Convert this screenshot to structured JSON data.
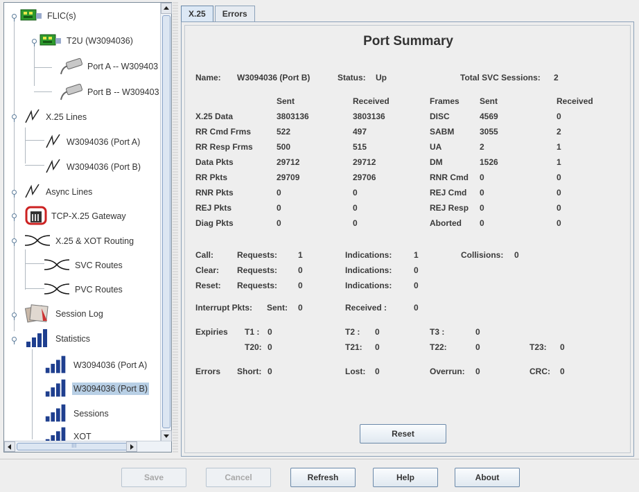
{
  "tree": {
    "items": [
      {
        "label": "FLIC(s)",
        "icon": "board-icon"
      },
      {
        "label": "T2U (W3094036)",
        "icon": "board-icon"
      },
      {
        "label": "Port A -- W309403",
        "icon": "cable-icon"
      },
      {
        "label": "Port B -- W309403",
        "icon": "cable-icon"
      },
      {
        "label": "X.25 Lines",
        "icon": "line-icon"
      },
      {
        "label": "W3094036 (Port A)",
        "icon": "line-icon"
      },
      {
        "label": "W3094036 (Port B)",
        "icon": "line-icon"
      },
      {
        "label": "Async Lines",
        "icon": "line-icon"
      },
      {
        "label": "TCP-X.25 Gateway",
        "icon": "gateway-icon"
      },
      {
        "label": "X.25 & XOT Routing",
        "icon": "routing-icon"
      },
      {
        "label": "SVC Routes",
        "icon": "routing-icon"
      },
      {
        "label": "PVC Routes",
        "icon": "routing-icon"
      },
      {
        "label": "Session Log",
        "icon": "log-icon"
      },
      {
        "label": "Statistics",
        "icon": "stats-icon"
      },
      {
        "label": "W3094036 (Port A)",
        "icon": "stats-icon"
      },
      {
        "label": "W3094036 (Port B)",
        "icon": "stats-icon"
      },
      {
        "label": "Sessions",
        "icon": "stats-icon"
      },
      {
        "label": "XOT",
        "icon": "stats-icon"
      }
    ],
    "hscroll_grip": "III"
  },
  "tabs": [
    {
      "label": "X.25"
    },
    {
      "label": "Errors"
    }
  ],
  "summary": {
    "title": "Port Summary",
    "name_label": "Name:",
    "name_value": "W3094036 (Port B)",
    "status_label": "Status:",
    "status_value": "Up",
    "total_svc_label": "Total SVC Sessions:",
    "total_svc_value": "2",
    "headers": {
      "sent": "Sent",
      "received": "Received",
      "frames": "Frames",
      "frames_sent": "Sent",
      "frames_received": "Received"
    },
    "rows": [
      {
        "label": "X.25 Data",
        "sent": "3803136",
        "received": "3803136",
        "frame": "DISC",
        "fsent": "4569",
        "freceived": "0"
      },
      {
        "label": "RR Cmd Frms",
        "sent": "522",
        "received": "497",
        "frame": "SABM",
        "fsent": "3055",
        "freceived": "2"
      },
      {
        "label": "RR Resp Frms",
        "sent": "500",
        "received": "515",
        "frame": "UA",
        "fsent": "2",
        "freceived": "1"
      },
      {
        "label": "Data Pkts",
        "sent": "29712",
        "received": "29712",
        "frame": "DM",
        "fsent": "1526",
        "freceived": "1"
      },
      {
        "label": "RR Pkts",
        "sent": "29709",
        "received": "29706",
        "frame": "RNR Cmd",
        "fsent": "0",
        "freceived": "0"
      },
      {
        "label": "RNR Pkts",
        "sent": "0",
        "received": "0",
        "frame": "REJ Cmd",
        "fsent": "0",
        "freceived": "0"
      },
      {
        "label": "REJ Pkts",
        "sent": "0",
        "received": "0",
        "frame": "REJ Resp",
        "fsent": "0",
        "freceived": "0"
      },
      {
        "label": "Diag Pkts",
        "sent": "0",
        "received": "0",
        "frame": "Aborted",
        "fsent": "0",
        "freceived": "0"
      }
    ],
    "call": {
      "label": "Call:",
      "requests_label": "Requests:",
      "requests": "1",
      "indications_label": "Indications:",
      "indications": "1",
      "collisions_label": "Collisions:",
      "collisions": "0"
    },
    "clear": {
      "label": "Clear:",
      "requests_label": "Requests:",
      "requests": "0",
      "indications_label": "Indications:",
      "indications": "0"
    },
    "reset": {
      "label": "Reset:",
      "requests_label": "Requests:",
      "requests": "0",
      "indications_label": "Indications:",
      "indications": "0"
    },
    "interrupt": {
      "label": "Interrupt Pkts:",
      "sent_label": "Sent:",
      "sent": "0",
      "received_label": "Received :",
      "received": "0"
    },
    "expiries": {
      "label": "Expiries",
      "t1": "T1 :",
      "t1v": "0",
      "t2": "T2 :",
      "t2v": "0",
      "t3": "T3 :",
      "t3v": "0",
      "t20": "T20:",
      "t20v": "0",
      "t21": "T21:",
      "t21v": "0",
      "t22": "T22:",
      "t22v": "0",
      "t23": "T23:",
      "t23v": "0"
    },
    "errors": {
      "label": "Errors",
      "short": "Short:",
      "shortv": "0",
      "lost": "Lost:",
      "lostv": "0",
      "overrun": "Overrun:",
      "overrunv": "0",
      "crc": "CRC:",
      "crcv": "0"
    },
    "reset_button": "Reset"
  },
  "buttons": {
    "save": "Save",
    "cancel": "Cancel",
    "refresh": "Refresh",
    "help": "Help",
    "about": "About"
  },
  "colors": {
    "selection": "#b8cfe5",
    "border": "#6a88a8",
    "board_green": "#2e9a2e",
    "gateway_red": "#cc2222",
    "stats_blue": "#1f3f8f"
  }
}
